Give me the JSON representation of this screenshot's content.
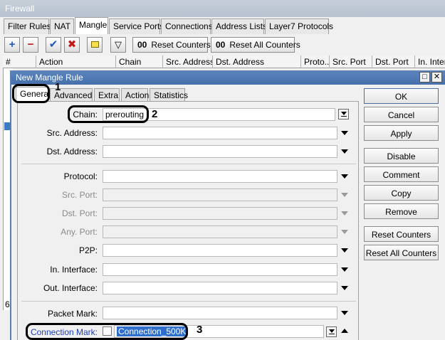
{
  "firewall": {
    "title": "Firewall",
    "tabs": [
      "Filter Rules",
      "NAT",
      "Mangle",
      "Service Ports",
      "Connections",
      "Address Lists",
      "Layer7 Protocols"
    ],
    "reset_counters": "Reset Counters",
    "reset_all_counters": "Reset All Counters",
    "oo": "00",
    "columns": [
      "#",
      "Action",
      "Chain",
      "Src. Address",
      "Dst. Address",
      "Proto...",
      "Src. Port",
      "Dst. Port",
      "In. Inter..."
    ],
    "row_count_fragment": "6"
  },
  "dialog": {
    "title": "New Mangle Rule",
    "tabs": [
      "General",
      "Advanced",
      "Extra",
      "Action",
      "Statistics"
    ],
    "fields": {
      "chain": {
        "label": "Chain:",
        "value": "prerouting"
      },
      "src_address": {
        "label": "Src. Address:",
        "value": ""
      },
      "dst_address": {
        "label": "Dst. Address:",
        "value": ""
      },
      "protocol": {
        "label": "Protocol:",
        "value": ""
      },
      "src_port": {
        "label": "Src. Port:",
        "value": ""
      },
      "dst_port": {
        "label": "Dst. Port:",
        "value": ""
      },
      "any_port": {
        "label": "Any. Port:",
        "value": ""
      },
      "p2p": {
        "label": "P2P:",
        "value": ""
      },
      "in_interface": {
        "label": "In. Interface:",
        "value": ""
      },
      "out_interface": {
        "label": "Out. Interface:",
        "value": ""
      },
      "packet_mark": {
        "label": "Packet Mark:",
        "value": ""
      },
      "connection_mark": {
        "label": "Connection Mark:",
        "value": "Connection_500K"
      }
    },
    "buttons": [
      "OK",
      "Cancel",
      "Apply",
      "Disable",
      "Comment",
      "Copy",
      "Remove",
      "Reset Counters",
      "Reset All Counters"
    ]
  },
  "annotations": [
    "1",
    "2",
    "3"
  ],
  "colors": {
    "title_bar": "#4670ab",
    "selection": "#2f6fcc",
    "blue_label": "#2040b0"
  }
}
